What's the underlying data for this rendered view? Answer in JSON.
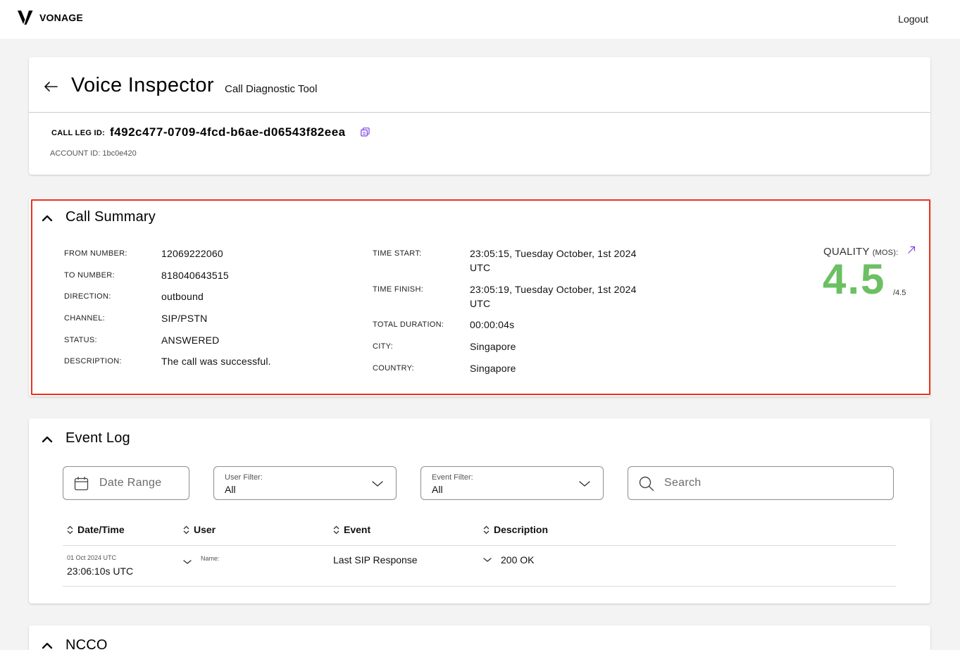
{
  "brand": {
    "name": "VONAGE",
    "logout_label": "Logout"
  },
  "header": {
    "title": "Voice Inspector",
    "subtitle": "Call Diagnostic Tool",
    "call_leg_label": "CALL LEG ID:",
    "call_leg_id": "f492c477-0709-4fcd-b6ae-d06543f82eea",
    "account_id": "ACCOUNT ID: 1bc0e420"
  },
  "summary": {
    "title": "Call Summary",
    "left": [
      {
        "label": "FROM NUMBER:",
        "value": "12069222060"
      },
      {
        "label": "TO NUMBER:",
        "value": "818040643515"
      },
      {
        "label": "DIRECTION:",
        "value": "outbound"
      },
      {
        "label": "CHANNEL:",
        "value": "SIP/PSTN"
      },
      {
        "label": "STATUS:",
        "value": "ANSWERED"
      },
      {
        "label": "DESCRIPTION:",
        "value": "The call was successful."
      }
    ],
    "right": [
      {
        "label": "TIME START:",
        "value": "23:05:15, Tuesday October, 1st 2024",
        "value2": "UTC"
      },
      {
        "label": "TIME FINISH:",
        "value": "23:05:19, Tuesday October, 1st 2024",
        "value2": "UTC"
      },
      {
        "label": "TOTAL DURATION:",
        "value": "00:00:04s"
      },
      {
        "label": "CITY:",
        "value": "Singapore"
      },
      {
        "label": "COUNTRY:",
        "value": "Singapore"
      }
    ],
    "quality": {
      "label": "QUALITY",
      "unit": "(MOS):",
      "value": "4.5",
      "max": "/4.5",
      "color": "#6cbf62"
    }
  },
  "event_log": {
    "title": "Event Log",
    "date_range_placeholder": "Date Range",
    "user_filter": {
      "label": "User Filter:",
      "value": "All"
    },
    "event_filter": {
      "label": "Event Filter:",
      "value": "All"
    },
    "search_placeholder": "Search",
    "columns": [
      "Date/Time",
      "User",
      "Event",
      "Description"
    ],
    "rows": [
      {
        "date": "01 Oct 2024 UTC",
        "time": "23:06:10s UTC",
        "user_label": "Name:",
        "event": "Last SIP Response",
        "description": "200 OK"
      }
    ]
  },
  "ncco": {
    "title": "NCCO"
  },
  "colors": {
    "accent": "#7b3fe4",
    "highlight": "#e8321e",
    "quality": "#6cbf62"
  }
}
